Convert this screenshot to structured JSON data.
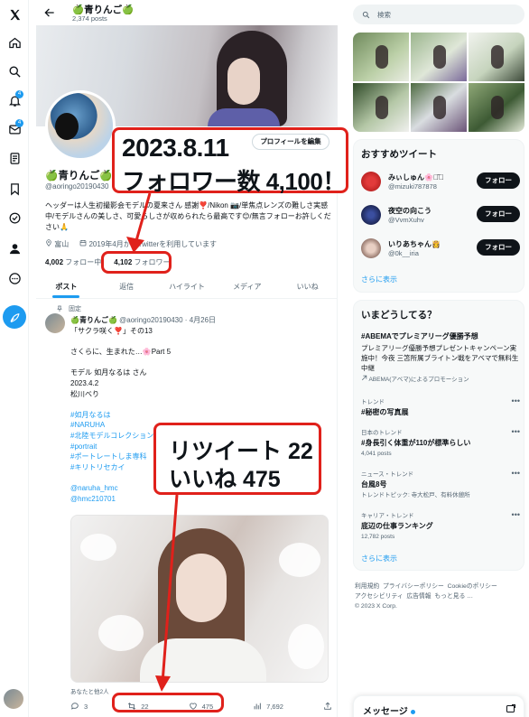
{
  "colors": {
    "accent": "#1d9bf0",
    "annotation_red": "#e0211b",
    "text": "#0f1419",
    "muted": "#536471"
  },
  "nav": {
    "icons": [
      "x-logo-icon",
      "home-icon",
      "search-icon",
      "notifications-icon",
      "messages-icon",
      "lists-icon",
      "bookmarks-icon",
      "verified-icon",
      "profile-icon",
      "more-icon",
      "post-icon"
    ],
    "notifications_badge": "4",
    "messages_badge": "4"
  },
  "header": {
    "name": "🍏青りんご🍏",
    "posts_count": "2,374 posts"
  },
  "profile": {
    "name": "🍏青りんご🍏",
    "handle": "@aoringo20190430",
    "edit_label": "プロフィールを編集",
    "bio": "ヘッダーは人生初撮影会モデルの夏来さん 感謝❣️/Nikon 📷/単焦点レンズの難しさ実感中/モデルさんの美しさ、可愛らしさが収められたら最高です😊/無言フォローお許しください🙏",
    "location": "富山",
    "joined": "2019年4月からTwitterを利用しています",
    "following_count": "4,002",
    "following_label": "フォロー中",
    "followers_count": "4,102",
    "followers_label": "フォロワー"
  },
  "tabs": [
    "ポスト",
    "返信",
    "ハイライト",
    "メディア",
    "いいね"
  ],
  "tweet": {
    "pinned_label": "固定",
    "author": "🍏青りんご🍏",
    "handle": "@aoringo20190430",
    "date": "4月26日",
    "lines": [
      "「サクラ咲く❣️」その13",
      "",
      "さくらに、生まれた…🌸Part 5",
      "",
      "モデル 如月なるは さん",
      "2023.4.2",
      "松川べり",
      "",
      "#如月なるは",
      "#NARUHA",
      "#北陸モデルコレクション",
      "#portrait",
      "#ポートレートしま専科",
      "#キリトリセカイ",
      "",
      "@naruha_hmc",
      "@hmc210701"
    ],
    "tagged": "あなたと他2人",
    "replies": "3",
    "retweets": "22",
    "likes": "475",
    "views": "7,692"
  },
  "annotations": {
    "date": "2023.8.11",
    "followers_note": "フォロワー数 4,100！",
    "retweet_note": "リツイート 22",
    "like_note": "いいね 475"
  },
  "right": {
    "search_placeholder": "検索",
    "recommended_title": "おすすめツイート",
    "recommended": [
      {
        "name": "みぃしゅん🌸◡̈⃝",
        "handle": "@mizuki787878",
        "button": "フォロー"
      },
      {
        "name": "夜空の向こう",
        "handle": "@VvmXuhv",
        "button": "フォロー"
      },
      {
        "name": "いりあちゃん👸",
        "handle": "@0k__iria",
        "button": "フォロー"
      }
    ],
    "show_more": "さらに表示",
    "trends_title": "いまどうしてる？",
    "promo": {
      "title": "#ABEMAでプレミアリーグ優勝予想",
      "text": "プレミアリーグ優勝予想プレゼントキャンペーン実施中！今夜 三笘所属ブライトン戦をアベマで無料生中継",
      "sponsor": "ABEMA(アベマ)によるプロモーション"
    },
    "trends": [
      {
        "context": "トレンド",
        "title": "#秘密の写真展",
        "sub": ""
      },
      {
        "context": "日本のトレンド",
        "title": "#身長引く体重が110が標準らしい",
        "sub": "4,041 posts"
      },
      {
        "context": "ニュース・トレンド",
        "title": "台風8号",
        "sub": "トレンドトピック: 寺大松戸、有料休憩所"
      },
      {
        "context": "キャリア・トレンド",
        "title": "底辺の仕事ランキング",
        "sub": "12,782 posts"
      }
    ],
    "footer": [
      "利用規約",
      "プライバシーポリシー",
      "Cookieのポリシー",
      "アクセシビリティ",
      "広告情報",
      "もっと見る …",
      "© 2023 X Corp."
    ],
    "messages_title": "メッセージ"
  }
}
